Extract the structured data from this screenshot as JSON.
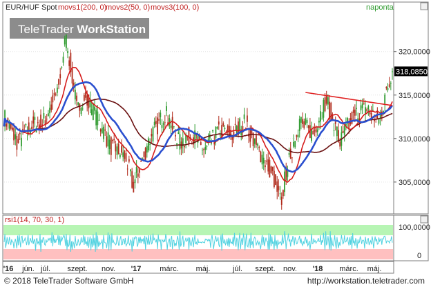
{
  "header": {
    "instrument_label": "EUR/HUF Spot",
    "indicator_1": "movs1(200, 0)",
    "indicator_2": "movs2(50, 0)",
    "indicator_3": "movs3(100, 0)",
    "period": "naponta",
    "watermark_brand_plain": "TeleTrader ",
    "watermark_brand_bold": "WorkStation"
  },
  "price_axis": {
    "ticks": [
      "320,0000",
      "315,0000",
      "310,0000",
      "305,0000"
    ],
    "current_value": "318,0850"
  },
  "rsi_panel": {
    "label": "rsi1(14, 70, 30, 1)",
    "ticks": [
      "100,0000",
      "0"
    ]
  },
  "time_axis": {
    "labels": [
      "'16",
      "jún.",
      "júl.",
      "szept.",
      "nov.",
      "'17",
      "márc.",
      "máj.",
      "júl.",
      "szept.",
      "nov.",
      "'18",
      "márc.",
      "máj."
    ]
  },
  "footer": {
    "copyright": "© 2018 TeleTrader Software GmbH",
    "url": "http://workstation.teletrader.com"
  },
  "colors": {
    "candle_up": "#2e9a2e",
    "candle_down": "#b02a1a",
    "ma_short": "#d51a1a",
    "ma_mid": "#2a4fcf",
    "ma_long": "#6a1010",
    "trendline": "#e02020",
    "rsi_line": "#4fd2e0",
    "overbought_zone": "#b7f5b4",
    "oversold_zone": "#ffc0c0"
  },
  "chart_data": {
    "type": "line",
    "ylim": [
      301.5,
      324.5
    ],
    "y_ticks": [
      305,
      310,
      315,
      320
    ],
    "x_range": [
      "2016-01-01",
      "2018-05-31"
    ],
    "close": {
      "x": [
        "2016-01-01",
        "2016-02-01",
        "2016-03-01",
        "2016-04-01",
        "2016-05-01",
        "2016-05-20",
        "2016-06-01",
        "2016-06-15",
        "2016-07-01",
        "2016-08-01",
        "2016-09-01",
        "2016-10-01",
        "2016-10-20",
        "2016-11-01",
        "2016-12-01",
        "2017-01-01",
        "2017-02-01",
        "2017-03-01",
        "2017-04-01",
        "2017-05-01",
        "2017-06-01",
        "2017-07-01",
        "2017-08-01",
        "2017-09-01",
        "2017-09-20",
        "2017-10-01",
        "2017-11-01",
        "2017-12-01",
        "2018-01-01",
        "2018-02-01",
        "2018-03-01",
        "2018-04-01",
        "2018-05-01",
        "2018-05-20",
        "2018-05-31"
      ],
      "y": [
        312.5,
        309.5,
        311.5,
        312.0,
        315.5,
        321.5,
        318.0,
        313.0,
        315.0,
        312.0,
        309.0,
        308.0,
        304.5,
        306.5,
        310.5,
        313.0,
        309.5,
        310.5,
        308.5,
        311.0,
        310.5,
        312.0,
        308.5,
        306.0,
        302.5,
        306.0,
        312.0,
        310.5,
        314.5,
        309.5,
        312.5,
        313.5,
        312.0,
        316.0,
        318.0
      ]
    },
    "rsi_levels": [
      70,
      30
    ],
    "rsi_range": [
      0,
      100
    ],
    "trendline": {
      "from": [
        "2017-11-15",
        315.3
      ],
      "to": [
        "2018-05-31",
        313.8
      ]
    }
  }
}
